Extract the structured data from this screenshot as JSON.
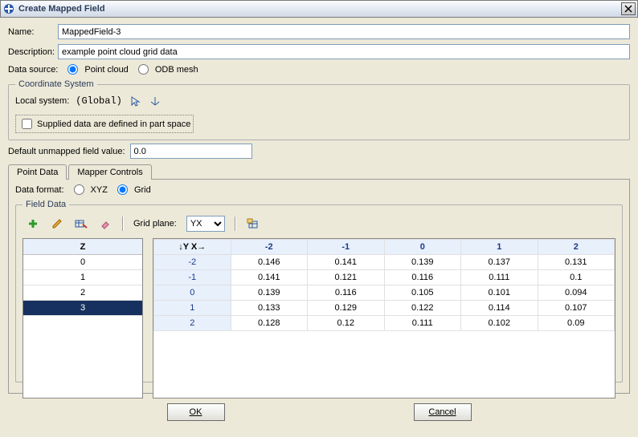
{
  "title": "Create Mapped Field",
  "name_label": "Name:",
  "name_value": "MappedField-3",
  "desc_label": "Description:",
  "desc_value": "example point cloud grid data",
  "data_source_label": "Data source:",
  "data_source_options": {
    "point_cloud": "Point cloud",
    "odb_mesh": "ODB mesh"
  },
  "data_source_selected": "point_cloud",
  "coord_legend": "Coordinate System",
  "local_system_label": "Local system:",
  "local_system_value": "(Global)",
  "supplied_checkbox": "Supplied data are defined in part space",
  "supplied_checked": false,
  "default_unmapped_label": "Default unmapped field value:",
  "default_unmapped_value": "0.0",
  "tabs": {
    "point_data": "Point Data",
    "mapper_controls": "Mapper Controls"
  },
  "active_tab": "point_data",
  "data_format_label": "Data format:",
  "data_format_options": {
    "xyz": "XYZ",
    "grid": "Grid"
  },
  "data_format_selected": "grid",
  "field_legend": "Field Data",
  "grid_plane_label": "Grid plane:",
  "grid_plane_value": "YX",
  "z_header": "Z",
  "z_values": [
    "0",
    "1",
    "2",
    "3"
  ],
  "z_selected_index": 3,
  "yx_header": "↓Y X→",
  "x_cols": [
    "-2",
    "-1",
    "0",
    "1",
    "2"
  ],
  "y_rows": [
    "-2",
    "-1",
    "0",
    "1",
    "2"
  ],
  "grid_values": [
    [
      "0.146",
      "0.141",
      "0.139",
      "0.137",
      "0.131"
    ],
    [
      "0.141",
      "0.121",
      "0.116",
      "0.111",
      "0.1"
    ],
    [
      "0.139",
      "0.116",
      "0.105",
      "0.101",
      "0.094"
    ],
    [
      "0.133",
      "0.129",
      "0.122",
      "0.114",
      "0.107"
    ],
    [
      "0.128",
      "0.12",
      "0.111",
      "0.102",
      "0.09"
    ]
  ],
  "ok_label": "OK",
  "cancel_label": "Cancel"
}
